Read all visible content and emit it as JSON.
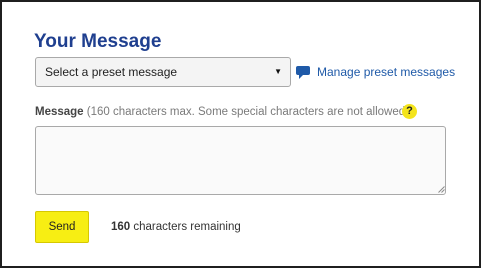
{
  "form": {
    "title": "Your Message",
    "preset_select": {
      "selected": "Select a preset message",
      "caret": "▼"
    },
    "manage_link": {
      "label": "Manage preset messages",
      "icon": "speech-bubble-icon"
    },
    "message_field": {
      "label": "Message",
      "hint": "(160 characters max. Some special characters are not allowed.)",
      "help_icon_text": "?",
      "value": ""
    },
    "send_label": "Send",
    "remaining": {
      "count": "160",
      "text": "characters remaining"
    }
  },
  "colors": {
    "title": "#1f3f8f",
    "link": "#1f5aa8",
    "button": "#f7ee13",
    "help_icon": "#f4e41c",
    "frame_border": "#1f1f1f"
  }
}
